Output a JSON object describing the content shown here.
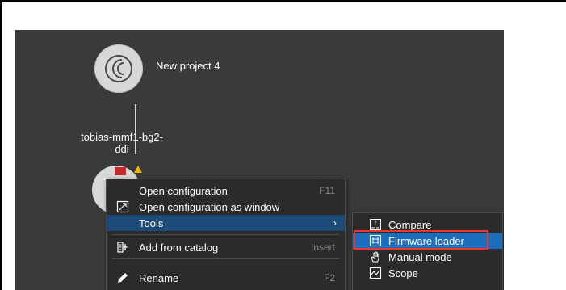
{
  "project": {
    "label": "New project 4"
  },
  "device": {
    "label_line1": "tobias-mmf1-bg2-",
    "label_line2": "ddi"
  },
  "context_menu": {
    "items": [
      {
        "label": "Open configuration",
        "shortcut": "F11",
        "icon": "none"
      },
      {
        "label": "Open configuration as window",
        "shortcut": "",
        "icon": "window-icon"
      },
      {
        "label": "Tools",
        "shortcut": "",
        "icon": "none",
        "has_submenu": true,
        "active": true
      },
      {
        "label": "Add from catalog",
        "shortcut": "Insert",
        "icon": "catalog-icon"
      },
      {
        "label": "Rename",
        "shortcut": "F2",
        "icon": "pencil-icon"
      }
    ]
  },
  "tools_submenu": {
    "items": [
      {
        "label": "Compare",
        "icon": "compare-icon"
      },
      {
        "label": "Firmware loader",
        "icon": "firmware-icon",
        "active": true
      },
      {
        "label": "Manual mode",
        "icon": "hand-icon"
      },
      {
        "label": "Scope",
        "icon": "scope-icon"
      }
    ]
  },
  "colors": {
    "canvas_bg": "#3a3a3a",
    "menu_bg": "#2b2b2b",
    "menu_active": "#1c4b7a",
    "submenu_active": "#1c6dbb",
    "highlight_border": "#e53935"
  }
}
